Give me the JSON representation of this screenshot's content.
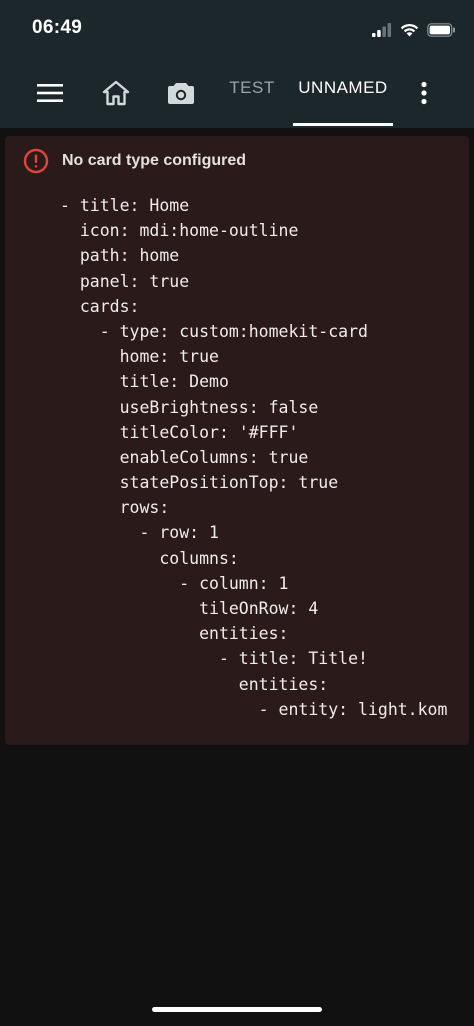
{
  "status_bar": {
    "time": "06:49"
  },
  "toolbar": {
    "icons": [
      "menu-icon",
      "home-icon",
      "camera-icon",
      "more-vertical-icon"
    ],
    "tabs": [
      {
        "label": "TEST",
        "active": false
      },
      {
        "label": "UNNAMED",
        "active": true
      }
    ]
  },
  "error_card": {
    "title": "No card type configured",
    "icon": "alert-circle-icon",
    "yaml_lines": [
      "- title: Home",
      "  icon: mdi:home-outline",
      "  path: home",
      "  panel: true",
      "  cards:",
      "    - type: custom:homekit-card",
      "      home: true",
      "      title: Demo",
      "      useBrightness: false",
      "      titleColor: '#FFF'",
      "      enableColumns: true",
      "      statePositionTop: true",
      "      rows:",
      "        - row: 1",
      "          columns:",
      "            - column: 1",
      "              tileOnRow: 4",
      "              entities:",
      "                - title: Title!",
      "                  entities:",
      "                    - entity: light.kom"
    ]
  },
  "colors": {
    "toolbar_bg": "#1c272b",
    "page_bg": "#111111",
    "card_bg": "#2a1a19",
    "error_red": "#e0453c"
  }
}
